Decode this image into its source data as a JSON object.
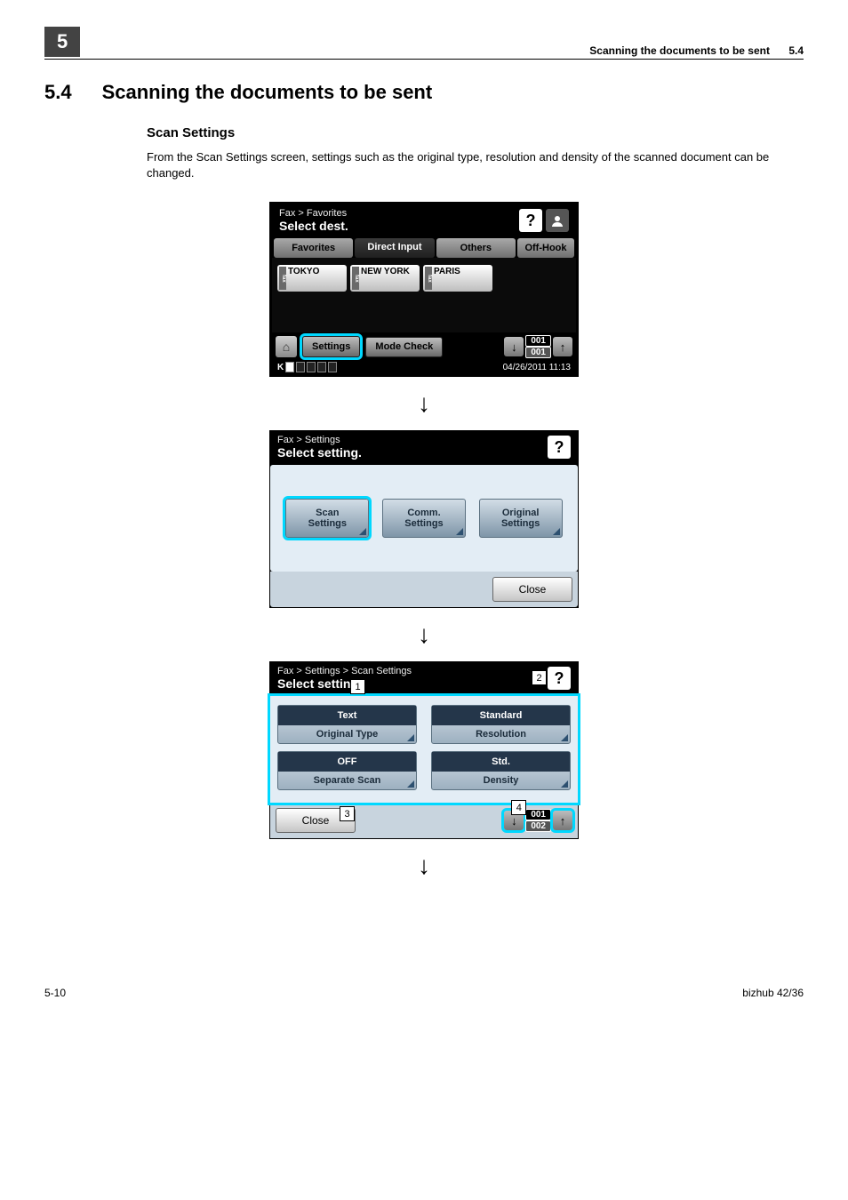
{
  "header": {
    "chapter": "5",
    "title": "Scanning the documents to be sent",
    "section": "5.4"
  },
  "page": {
    "section_number": "5.4",
    "section_title": "Scanning the documents to be sent",
    "subtitle": "Scan Settings",
    "body": "From the Scan Settings screen, settings such as the original type, resolution and density of the scanned document can be changed."
  },
  "panel1": {
    "breadcrumb": "Fax > Favorites",
    "heading": "Select dest.",
    "tabs": {
      "favorites": "Favorites",
      "direct": "Direct Input",
      "others": "Others",
      "offhook": "Off-Hook"
    },
    "favs": {
      "a": "TOKYO",
      "b": "NEW YORK",
      "c": "PARIS",
      "tag": "fax"
    },
    "settings": "Settings",
    "modecheck": "Mode Check",
    "mem": {
      "top": "001",
      "bot": "001"
    },
    "datetime": "04/26/2011  11:13",
    "toner_label": "K"
  },
  "panel2": {
    "breadcrumb": "Fax > Settings",
    "heading": "Select setting.",
    "scan": {
      "l1": "Scan",
      "l2": "Settings"
    },
    "comm": {
      "l1": "Comm.",
      "l2": "Settings"
    },
    "orig": {
      "l1": "Original",
      "l2": "Settings"
    },
    "close": "Close"
  },
  "panel3": {
    "breadcrumb": "Fax > Settings > Scan Settings",
    "heading": "Select setting.",
    "original_type": {
      "value": "Text",
      "label": "Original Type"
    },
    "resolution": {
      "value": "Standard",
      "label": "Resolution"
    },
    "separate_scan": {
      "value": "OFF",
      "label": "Separate Scan"
    },
    "density": {
      "value": "Std.",
      "label": "Density"
    },
    "close": "Close",
    "mem": {
      "top": "001",
      "bot": "002"
    }
  },
  "callouts": {
    "c1": "1",
    "c2": "2",
    "c3": "3",
    "c4": "4"
  },
  "footer": {
    "left": "5-10",
    "right": "bizhub 42/36"
  }
}
